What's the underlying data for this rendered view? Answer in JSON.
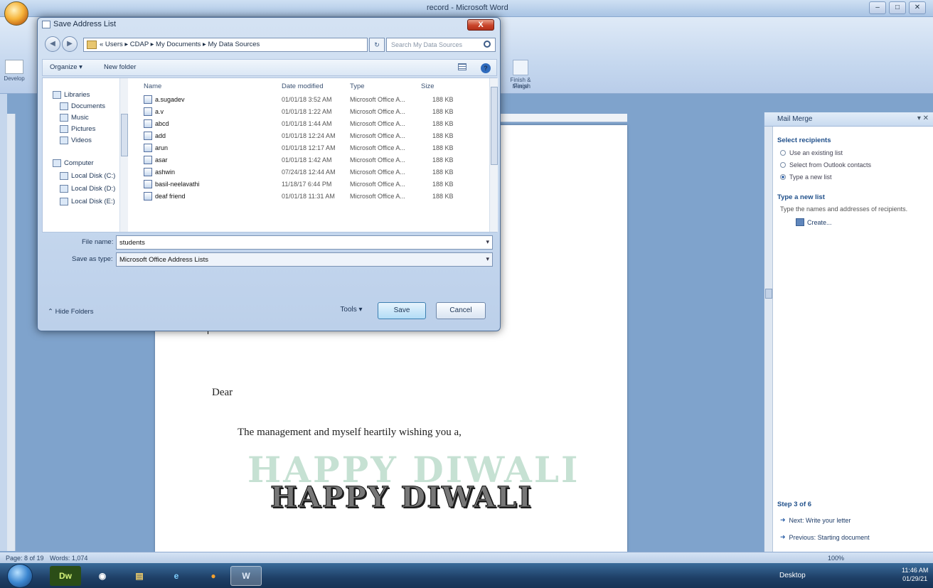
{
  "window": {
    "title": "record - Microsoft Word"
  },
  "ribbon": {
    "developer_label": "Develop",
    "finish_label": "Finish & Merge",
    "finish_group": "Finish"
  },
  "document": {
    "dear": "Dear",
    "line1": "The management and myself heartily wishing you a,",
    "wordart_shadow": "HAPPY DIWALI",
    "wordart_main": "HAPPY DIWALI"
  },
  "mail_merge": {
    "title": "Mail Merge",
    "select_recipients": "Select recipients",
    "options": [
      {
        "label": "Use an existing list",
        "selected": false
      },
      {
        "label": "Select from Outlook contacts",
        "selected": false
      },
      {
        "label": "Type a new list",
        "selected": true
      }
    ],
    "type_new_list_heading": "Type a new list",
    "type_new_list_desc": "Type the names and addresses of recipients.",
    "create_link": "Create...",
    "step": "Step 3 of 6",
    "next": "Next: Write your letter",
    "previous": "Previous: Starting document"
  },
  "statusbar": {
    "page": "Page: 8 of 19",
    "words": "Words: 1,074",
    "zoom": "100%"
  },
  "dialog": {
    "title": "Save Address List",
    "close": "X",
    "breadcrumb": "« Users ▸ CDAP ▸ My Documents ▸ My Data Sources",
    "search_placeholder": "Search My Data Sources",
    "organize": "Organize ▾",
    "new_folder": "New folder",
    "nav": {
      "libraries": "Libraries",
      "documents": "Documents",
      "music": "Music",
      "pictures": "Pictures",
      "videos": "Videos",
      "computer": "Computer",
      "local_c": "Local Disk (C:)",
      "local_d": "Local Disk (D:)",
      "local_e": "Local Disk (E:)"
    },
    "columns": {
      "name": "Name",
      "date": "Date modified",
      "type": "Type",
      "size": "Size"
    },
    "files": [
      {
        "name": "a.sugadev",
        "date": "01/01/18 3:52 AM",
        "type": "Microsoft Office A...",
        "size": "188 KB"
      },
      {
        "name": "a.v",
        "date": "01/01/18 1:22 AM",
        "type": "Microsoft Office A...",
        "size": "188 KB"
      },
      {
        "name": "abcd",
        "date": "01/01/18 1:44 AM",
        "type": "Microsoft Office A...",
        "size": "188 KB"
      },
      {
        "name": "add",
        "date": "01/01/18 12:24 AM",
        "type": "Microsoft Office A...",
        "size": "188 KB"
      },
      {
        "name": "arun",
        "date": "01/01/18 12:17 AM",
        "type": "Microsoft Office A...",
        "size": "188 KB"
      },
      {
        "name": "asar",
        "date": "01/01/18 1:42 AM",
        "type": "Microsoft Office A...",
        "size": "188 KB"
      },
      {
        "name": "ashwin",
        "date": "07/24/18 12:44 AM",
        "type": "Microsoft Office A...",
        "size": "188 KB"
      },
      {
        "name": "basil-neelavathi",
        "date": "11/18/17 6:44 PM",
        "type": "Microsoft Office A...",
        "size": "188 KB"
      },
      {
        "name": "deaf friend",
        "date": "01/01/18 11:31 AM",
        "type": "Microsoft Office A...",
        "size": "188 KB"
      }
    ],
    "file_name_label": "File name:",
    "file_name_value": "students",
    "save_type_label": "Save as type:",
    "save_type_value": "Microsoft Office Address Lists",
    "hide_folders": "Hide Folders",
    "tools": "Tools",
    "save": "Save",
    "cancel": "Cancel"
  },
  "taskbar": {
    "desktop": "Desktop",
    "time": "11:46 AM",
    "date": "01/29/21"
  }
}
